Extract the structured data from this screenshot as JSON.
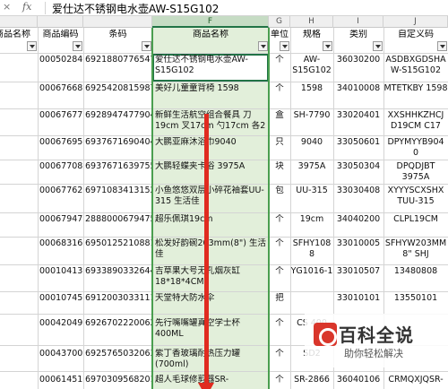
{
  "formula_bar": {
    "cancel_icon": "×",
    "fx_label": "fx",
    "content": "爱仕达不锈钢电水壶AW-S15G102"
  },
  "columns": {
    "c0": "",
    "c1": "",
    "c2": "",
    "c3": "F",
    "c4": "G",
    "c5": "H",
    "c6": "I",
    "c7": "J"
  },
  "header": {
    "name": "商品名称",
    "code": "商品编码",
    "barcode": "条码",
    "goods_name": "商品名称",
    "unit": "单位",
    "spec": "规格",
    "category": "类别",
    "custom_code": "自定义码"
  },
  "rows": [
    {
      "code": "00050284",
      "barcode": "6921880776547",
      "name": "爱仕达不锈钢电水壶AW-S15G102",
      "unit": "个",
      "spec": "AW-S15G102",
      "category": "36030200",
      "custom": "ASDBXGDSHA W-S15G102"
    },
    {
      "code": "00067668",
      "barcode": "6925420815987",
      "name": "美好儿童童背椅 1598",
      "unit": "个",
      "spec": "1598",
      "category": "34010008",
      "custom": "MTETKBY 1598"
    },
    {
      "code": "00067677",
      "barcode": "6928947477904",
      "name": "新鲜生活航空组合餐具 刀 19cm 叉17cm 勺17cm 各2 ",
      "unit": "盒",
      "spec": "SH-7790",
      "category": "33020401",
      "custom": "XXSHHKZHCJ D19CM C17"
    },
    {
      "code": "00067695",
      "barcode": "6937671690404",
      "name": "大鹏亚麻沐浴巾9040",
      "unit": "只",
      "spec": "9040",
      "category": "33050601",
      "custom": "DPYMYYB904 0"
    },
    {
      "code": "00067708",
      "barcode": "6937671639755",
      "name": "大鹏轻蝶夹卡浴 3975A",
      "unit": "块",
      "spec": "3975A",
      "category": "33050304",
      "custom": "DPQDJBT 3975A"
    },
    {
      "code": "00067762",
      "barcode": "6971083413152",
      "name": "小鱼悠悠双层小碎花袖套UU-315 生活佳",
      "unit": "包",
      "spec": "UU-315",
      "category": "33030408",
      "custom": "XYYYSCXSHX TUU-315"
    },
    {
      "code": "00067947",
      "barcode": "2888000679475",
      "name": "超乐佩琪19cm",
      "unit": "个",
      "spec": "19cm",
      "category": "34040200",
      "custom": "CLPL19CM"
    },
    {
      "code": "00068316",
      "barcode": "6950125210881",
      "name": "松发好韵碗203mm(8\") 生活佳",
      "unit": "个",
      "spec": "SFHY108 8",
      "category": "33010005",
      "custom": "SFHYW203MM 8\" SHJ"
    },
    {
      "code": "00010413",
      "barcode": "6933890332644",
      "name": "吉草果大号无孔烟灰缸 18*18*4CM",
      "unit": "个",
      "spec": "YG1016-1",
      "category": "33010507",
      "custom": "13480808"
    },
    {
      "code": "00010745",
      "barcode": "6912003033111",
      "name": "天堂特大防水伞",
      "unit": "把",
      "spec": "",
      "category": "33010101",
      "custom": "13550101"
    },
    {
      "code": "00042049",
      "barcode": "6926702220062",
      "name": "先行嘴嘴罐真空学士杯 400ML",
      "unit": "个",
      "spec": "CS 400",
      "category": "",
      "custom": ""
    },
    {
      "code": "00043700",
      "barcode": "6925765032063",
      "name": "紫丁香玻璃耐热压力罐(700ml)",
      "unit": "个",
      "spec": "SD2",
      "category": "",
      "custom": ""
    },
    {
      "code": "00061451",
      "barcode": "6970309568201",
      "name": "超人毛球修剪器SR-",
      "unit": "个",
      "spec": "SR-2866",
      "category": "36040106",
      "custom": "CRMQXJQSR-"
    }
  ],
  "watermark": {
    "title": "百科全说",
    "subtitle": "助你轻松解决"
  },
  "colors": {
    "selection_fill": "#e2efda",
    "selection_border": "#217346",
    "arrow": "#e02b20"
  }
}
